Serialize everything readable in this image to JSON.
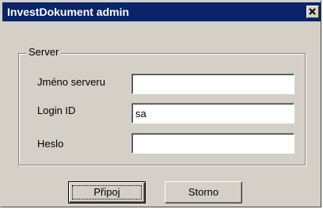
{
  "window": {
    "title": "InvestDokument admin",
    "close_icon": "close-icon"
  },
  "server_group": {
    "legend": "Server",
    "fields": {
      "server_name": {
        "label": "Jméno serveru",
        "value": ""
      },
      "login_id": {
        "label": "Login ID",
        "value": "sa"
      },
      "password": {
        "label": "Heslo",
        "value": ""
      }
    }
  },
  "buttons": {
    "connect": "Připoj",
    "cancel": "Storno"
  },
  "colors": {
    "titlebar": "#0a246a",
    "face": "#d4d0c8"
  }
}
